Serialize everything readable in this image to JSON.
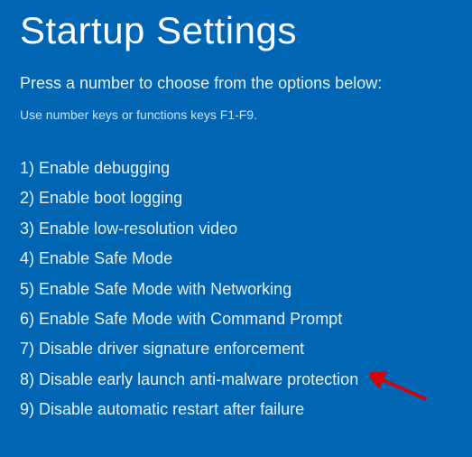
{
  "title": "Startup Settings",
  "subtitle": "Press a number to choose from the options below:",
  "hint": "Use number keys or functions keys F1-F9.",
  "options": [
    {
      "num": "1)",
      "label": "Enable debugging"
    },
    {
      "num": "2)",
      "label": "Enable boot logging"
    },
    {
      "num": "3)",
      "label": "Enable low-resolution video"
    },
    {
      "num": "4)",
      "label": "Enable Safe Mode"
    },
    {
      "num": "5)",
      "label": "Enable Safe Mode with Networking"
    },
    {
      "num": "6)",
      "label": "Enable Safe Mode with Command Prompt"
    },
    {
      "num": "7)",
      "label": "Disable driver signature enforcement"
    },
    {
      "num": "8)",
      "label": "Disable early launch anti-malware protection"
    },
    {
      "num": "9)",
      "label": "Disable automatic restart after failure"
    }
  ],
  "annotation": {
    "arrow_target_index": 6,
    "arrow_color": "#d80000"
  }
}
